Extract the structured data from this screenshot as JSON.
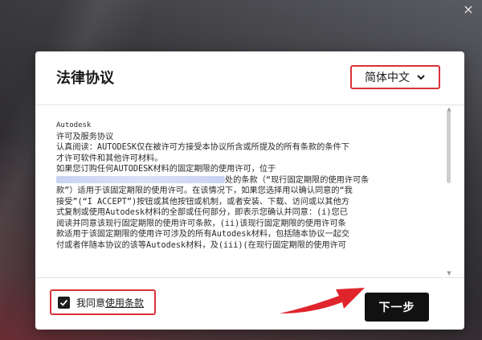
{
  "window": {
    "close_label": "×"
  },
  "dialog": {
    "title": "法律协议",
    "language": {
      "selected": "简体中文"
    },
    "agreement_lines": [
      "Autodesk",
      "许可及服务协议",
      "认真阅读：AUTODESK仅在被许可方接受本协议所含或所提及的所有条款的条件下",
      "才许可软件和其他许可材料。",
      "如果您订购任何AUTODESK材料的固定期限的使用许可，位于",
      "处的条款（“现行固定期限的使用许可条",
      "款”）适用于该固定期限的使用许可。在该情况下，如果您选择用以确认同意的“我",
      "接受”(“I ACCEPT”)按钮或其他按钮或机制，或者安装、下载、访问或以其他方",
      "式复制或使用Autodesk材料的全部或任何部分，即表示您确认并同意：(i)您已",
      "阅读并同意该现行固定期限的使用许可条款，(ii)该现行固定期限的使用许可条",
      "款适用于该固定期限的使用许可涉及的所有Autodesk材料，包括随本协议一起交",
      "付或者伴随本协议的该等Autodesk材料，及(iii)(在现行固定期限的使用许可"
    ],
    "agree": {
      "prefix": "我同意",
      "link": "使用条款",
      "checked": true
    },
    "next_button": "下一步"
  }
}
